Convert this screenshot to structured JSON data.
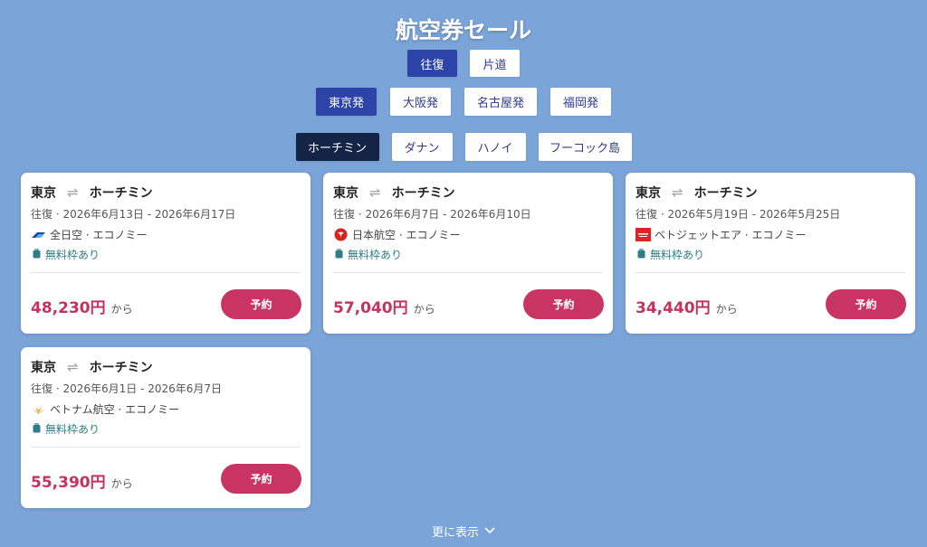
{
  "title": "航空券セール",
  "trip_types": [
    {
      "label": "往復",
      "active": true
    },
    {
      "label": "片道",
      "active": false
    }
  ],
  "origins": [
    {
      "label": "東京発",
      "active": true
    },
    {
      "label": "大阪発",
      "active": false
    },
    {
      "label": "名古屋発",
      "active": false
    },
    {
      "label": "福岡発",
      "active": false
    }
  ],
  "destinations": [
    {
      "label": "ホーチミン",
      "active": true
    },
    {
      "label": "ダナン",
      "active": false
    },
    {
      "label": "ハノイ",
      "active": false
    },
    {
      "label": "フーコック島",
      "active": false
    }
  ],
  "cards": [
    {
      "from": "東京",
      "to": "ホーチミン",
      "dates": "往復 · 2026年6月13日 - 2026年6月17日",
      "airline": "全日空 · エコノミー",
      "baggage": "無料枠あり",
      "price": "48,230円",
      "from_label": "から",
      "book": "予約"
    },
    {
      "from": "東京",
      "to": "ホーチミン",
      "dates": "往復 · 2026年6月7日 - 2026年6月10日",
      "airline": "日本航空 · エコノミー",
      "baggage": "無料枠あり",
      "price": "57,040円",
      "from_label": "から",
      "book": "予約"
    },
    {
      "from": "東京",
      "to": "ホーチミン",
      "dates": "往復 · 2026年5月19日 - 2026年5月25日",
      "airline": "ベトジェットエア · エコノミー",
      "baggage": "無料枠あり",
      "price": "34,440円",
      "from_label": "から",
      "book": "予約"
    },
    {
      "from": "東京",
      "to": "ホーチミン",
      "dates": "往復 · 2026年6月1日 - 2026年6月7日",
      "airline": "ベトナム航空 · エコノミー",
      "baggage": "無料枠あり",
      "price": "55,390円",
      "from_label": "から",
      "book": "予約"
    }
  ],
  "show_more": "更に表示",
  "colors": {
    "background": "#7ba4d8",
    "active_blue": "#2c43a8",
    "active_dark": "#142447",
    "price": "#c4335e",
    "button": "#c93562",
    "baggage": "#2f7d86"
  }
}
